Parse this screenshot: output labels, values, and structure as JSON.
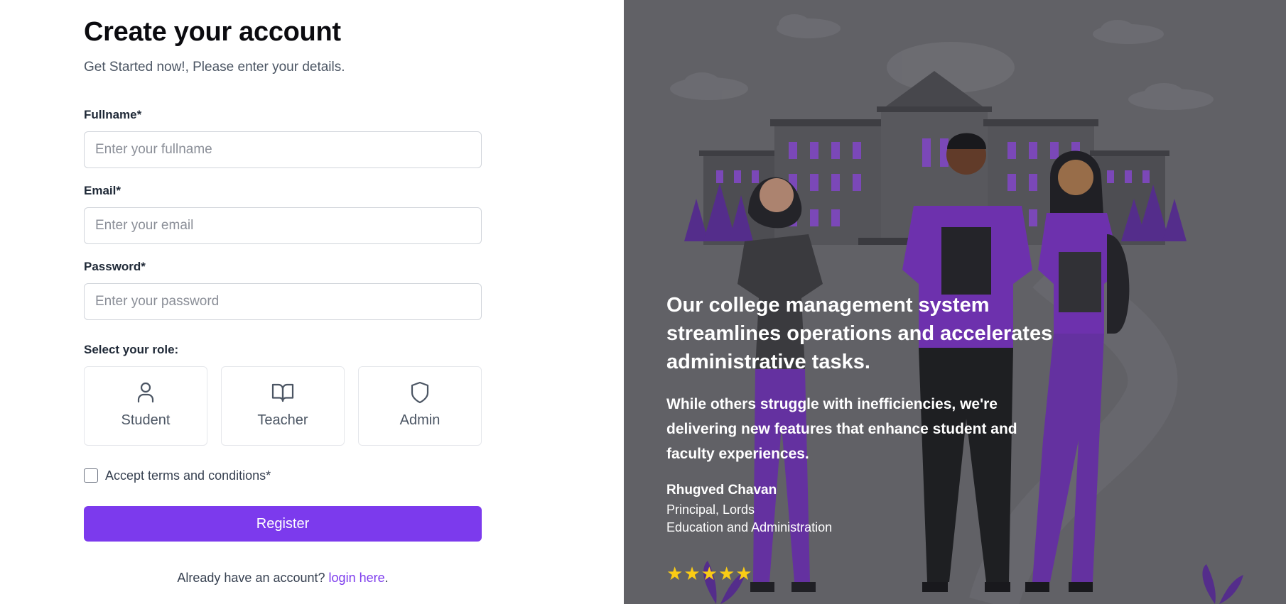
{
  "form": {
    "title": "Create your account",
    "subtitle": "Get Started now!, Please enter your details.",
    "fields": {
      "fullname": {
        "label": "Fullname*",
        "placeholder": "Enter your fullname"
      },
      "email": {
        "label": "Email*",
        "placeholder": "Enter your email"
      },
      "password": {
        "label": "Password*",
        "placeholder": "Enter your password"
      }
    },
    "roles_label": "Select your role:",
    "roles": [
      {
        "label": "Student",
        "icon": "user-icon"
      },
      {
        "label": "Teacher",
        "icon": "book-open-icon"
      },
      {
        "label": "Admin",
        "icon": "shield-icon"
      }
    ],
    "terms_label": "Accept terms and conditions*",
    "terms_checked": false,
    "register_label": "Register",
    "login_prompt": "Already have an account?",
    "login_link": "login here",
    "login_suffix": "."
  },
  "testimonial": {
    "headline": "Our college management system streamlines operations and accelerates administrative tasks.",
    "body": "While others struggle with inefficiencies, we're delivering new features that enhance student and faculty experiences.",
    "author": "Rhugved Chavan",
    "position": "Principal, Lords",
    "organization": "Education and Administration",
    "rating": 5
  },
  "colors": {
    "accent": "#7c3aed",
    "panel_bg": "#6b6b70",
    "star": "#facc15"
  }
}
